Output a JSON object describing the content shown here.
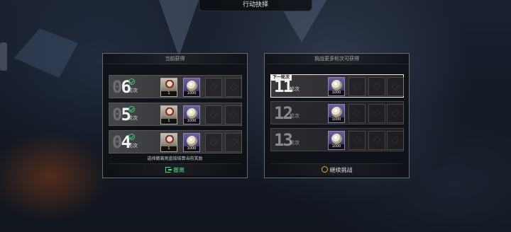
{
  "header": {
    "title": "行动抉择"
  },
  "left_panel": {
    "title": "当前获得",
    "rows": [
      {
        "digit_zero": "0",
        "digit": "6",
        "unit": "轮次",
        "completed": true,
        "rewards": [
          {
            "icon": "character-card",
            "count": "1"
          },
          {
            "icon": "coin-card",
            "count": "1000"
          }
        ]
      },
      {
        "digit_zero": "0",
        "digit": "5",
        "unit": "轮次",
        "completed": true,
        "rewards": [
          {
            "icon": "character-card",
            "count": "1"
          },
          {
            "icon": "coin-card",
            "count": "1000"
          }
        ]
      },
      {
        "digit_zero": "0",
        "digit": "4",
        "unit": "轮次",
        "completed": true,
        "rewards": [
          {
            "icon": "character-card",
            "count": "1"
          },
          {
            "icon": "coin-card",
            "count": "1000"
          }
        ]
      }
    ],
    "hint": "选择撤离则直接结算当前奖励",
    "action_label": "撤离",
    "action_color": "#4fd884"
  },
  "right_panel": {
    "title": "挑战更多轮次可获得",
    "rows": [
      {
        "num": "11",
        "unit": "轮次",
        "tag": "下一轮次",
        "reward": {
          "icon": "coin-card",
          "count": "1000"
        }
      },
      {
        "num": "12",
        "unit": "轮次",
        "reward": {
          "icon": "coin-card",
          "count": "1000"
        }
      },
      {
        "num": "13",
        "unit": "轮次",
        "reward": {
          "icon": "coin-card",
          "count": "1000"
        }
      }
    ],
    "action_label": "继续挑战",
    "action_icon_color": "#e0a83a"
  }
}
